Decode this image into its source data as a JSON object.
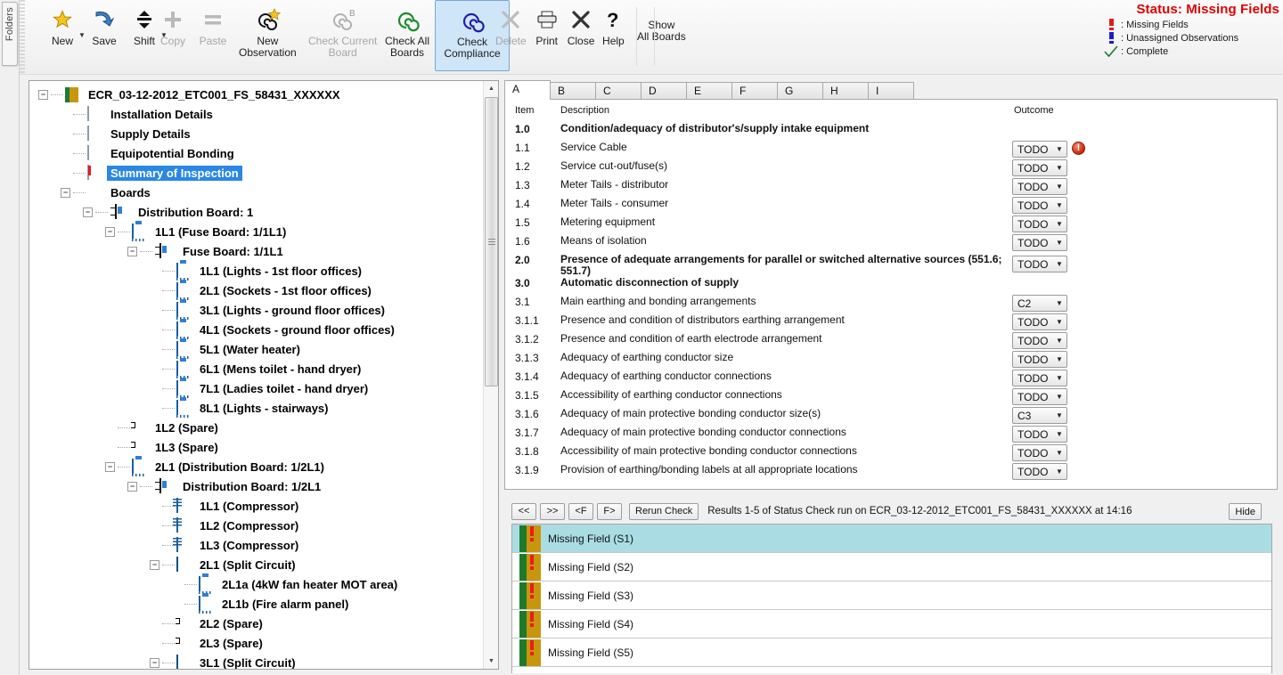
{
  "dock": {
    "folders_tab": "Folders"
  },
  "toolbar": {
    "buttons": [
      {
        "label": "New",
        "icon": "star-icon",
        "disabled": false,
        "dropdown": true
      },
      {
        "label": "Save",
        "icon": "save-icon",
        "disabled": false,
        "dropdown": false
      },
      {
        "label": "Shift",
        "icon": "shift-arrows-icon",
        "disabled": false,
        "dropdown": true
      },
      {
        "label": "Copy",
        "icon": "plus-icon",
        "disabled": true,
        "dropdown": false
      },
      {
        "label": "Paste",
        "icon": "equals-icon",
        "disabled": true,
        "dropdown": false
      },
      {
        "label": "New\nObservation",
        "icon": "spiral-star-icon",
        "disabled": false,
        "dropdown": false
      },
      {
        "label": "Check Current\nBoard",
        "icon": "spiral-b-icon",
        "disabled": true,
        "dropdown": false
      },
      {
        "label": "Check All\nBoards",
        "icon": "spiral-green-icon",
        "disabled": false,
        "dropdown": false
      },
      {
        "label": "Check\nCompliance",
        "icon": "spiral-blue-icon",
        "disabled": false,
        "dropdown": false,
        "active": true
      },
      {
        "label": "Delete",
        "icon": "x-delete-icon",
        "disabled": true,
        "dropdown": false
      },
      {
        "label": "Print",
        "icon": "printer-icon",
        "disabled": false,
        "dropdown": false
      },
      {
        "label": "Close",
        "icon": "x-close-icon",
        "disabled": false,
        "dropdown": false
      },
      {
        "label": "Help",
        "icon": "question-mark-icon",
        "disabled": false,
        "dropdown": false
      },
      {
        "label": "Show\nAll Boards",
        "icon": "none",
        "disabled": false,
        "dropdown": false
      }
    ]
  },
  "status": {
    "title": "Status: Missing Fields",
    "legend": [
      {
        "icon": "red-exclamation-icon",
        "color": "#e01b1b",
        "label": ": Missing Fields"
      },
      {
        "icon": "blue-exclamation-icon",
        "color": "#1b1bd0",
        "label": ": Unassigned Observations"
      },
      {
        "icon": "green-check-icon",
        "color": "#1d7a2b",
        "label": ": Complete"
      }
    ]
  },
  "tree": {
    "root": "ECR_03-12-2012_ETC001_FS_58431_XXXXXX",
    "items": [
      {
        "label": "ECR_03-12-2012_ETC001_FS_58431_XXXXXX",
        "indent": 0,
        "icon": "project-icon",
        "expander": "minus",
        "selected": false
      },
      {
        "label": "Installation Details",
        "indent": 1,
        "icon": "document-icon",
        "expander": "none",
        "selected": false
      },
      {
        "label": "Supply Details",
        "indent": 1,
        "icon": "document-icon",
        "expander": "none",
        "selected": false
      },
      {
        "label": "Equipotential Bonding",
        "indent": 1,
        "icon": "document-icon",
        "expander": "none",
        "selected": false
      },
      {
        "label": "Summary of Inspection",
        "indent": 1,
        "icon": "document-warning-icon",
        "expander": "none",
        "selected": true
      },
      {
        "label": "Boards",
        "indent": 1,
        "icon": "none",
        "expander": "minus",
        "selected": false
      },
      {
        "label": "Distribution Board: 1",
        "indent": 2,
        "icon": "board-icon",
        "expander": "minus",
        "selected": false
      },
      {
        "label": "1L1 (Fuse Board: 1/1L1)",
        "indent": 3,
        "icon": "way-icon",
        "expander": "minus",
        "selected": false
      },
      {
        "label": "Fuse Board: 1/1L1",
        "indent": 4,
        "icon": "board-icon",
        "expander": "minus",
        "selected": false
      },
      {
        "label": "1L1 (Lights - 1st floor offices)",
        "indent": 5,
        "icon": "way-icon",
        "expander": "none",
        "selected": false
      },
      {
        "label": "2L1 (Sockets - 1st floor offices)",
        "indent": 5,
        "icon": "way-icon",
        "expander": "none",
        "selected": false
      },
      {
        "label": "3L1 (Lights - ground floor offices)",
        "indent": 5,
        "icon": "way-icon",
        "expander": "none",
        "selected": false
      },
      {
        "label": "4L1 (Sockets - ground floor offices)",
        "indent": 5,
        "icon": "way-icon",
        "expander": "none",
        "selected": false
      },
      {
        "label": "5L1 (Water heater)",
        "indent": 5,
        "icon": "way-icon",
        "expander": "none",
        "selected": false
      },
      {
        "label": "6L1 (Mens toilet - hand dryer)",
        "indent": 5,
        "icon": "way-icon",
        "expander": "none",
        "selected": false
      },
      {
        "label": "7L1 (Ladies toilet - hand dryer)",
        "indent": 5,
        "icon": "way-icon",
        "expander": "none",
        "selected": false
      },
      {
        "label": "8L1 (Lights - stairways)",
        "indent": 5,
        "icon": "way-icon",
        "expander": "none",
        "selected": false
      },
      {
        "label": "1L2 (Spare)",
        "indent": 3,
        "icon": "spare-icon",
        "expander": "none",
        "selected": false
      },
      {
        "label": "1L3 (Spare)",
        "indent": 3,
        "icon": "spare-icon",
        "expander": "none",
        "selected": false
      },
      {
        "label": "2L1 (Distribution Board: 1/2L1)",
        "indent": 3,
        "icon": "way-icon",
        "expander": "minus",
        "selected": false
      },
      {
        "label": "Distribution Board: 1/2L1",
        "indent": 4,
        "icon": "board-icon",
        "expander": "minus",
        "selected": false
      },
      {
        "label": "1L1 (Compressor)",
        "indent": 5,
        "icon": "circuit-icon",
        "expander": "none",
        "selected": false
      },
      {
        "label": "1L2 (Compressor)",
        "indent": 5,
        "icon": "circuit-icon",
        "expander": "none",
        "selected": false
      },
      {
        "label": "1L3 (Compressor)",
        "indent": 5,
        "icon": "circuit-icon",
        "expander": "none",
        "selected": false
      },
      {
        "label": "2L1 (Split Circuit)",
        "indent": 5,
        "icon": "split-circuit-icon",
        "expander": "minus",
        "selected": false
      },
      {
        "label": "2L1a (4kW fan heater MOT area)",
        "indent": 6,
        "icon": "way-icon",
        "expander": "none",
        "selected": false
      },
      {
        "label": "2L1b (Fire alarm panel)",
        "indent": 6,
        "icon": "way-icon",
        "expander": "none",
        "selected": false
      },
      {
        "label": "2L2 (Spare)",
        "indent": 5,
        "icon": "spare-icon",
        "expander": "none",
        "selected": false
      },
      {
        "label": "2L3 (Spare)",
        "indent": 5,
        "icon": "spare-icon",
        "expander": "none",
        "selected": false
      },
      {
        "label": "3L1 (Split Circuit)",
        "indent": 5,
        "icon": "split-circuit-icon",
        "expander": "minus",
        "selected": false
      }
    ]
  },
  "content": {
    "tabs": [
      {
        "label": "A",
        "active": true
      },
      {
        "label": "B",
        "active": false
      },
      {
        "label": "C",
        "active": false
      },
      {
        "label": "D",
        "active": false
      },
      {
        "label": "E",
        "active": false
      },
      {
        "label": "F",
        "active": false
      },
      {
        "label": "G",
        "active": false
      },
      {
        "label": "H",
        "active": false
      },
      {
        "label": "I",
        "active": false
      }
    ],
    "columns": {
      "item": "Item",
      "description": "Description",
      "outcome": "Outcome"
    },
    "rows": [
      {
        "item": "1.0",
        "description": "Condition/adequacy of distributor's/supply intake equipment",
        "outcome": null,
        "section": true,
        "badge": null
      },
      {
        "item": "1.1",
        "description": "Service Cable",
        "outcome": "TODO",
        "section": false,
        "badge": "!"
      },
      {
        "item": "1.2",
        "description": "Service cut-out/fuse(s)",
        "outcome": "TODO",
        "section": false,
        "badge": null
      },
      {
        "item": "1.3",
        "description": "Meter Tails - distributor",
        "outcome": "TODO",
        "section": false,
        "badge": null
      },
      {
        "item": "1.4",
        "description": "Meter Tails - consumer",
        "outcome": "TODO",
        "section": false,
        "badge": null
      },
      {
        "item": "1.5",
        "description": "Metering equipment",
        "outcome": "TODO",
        "section": false,
        "badge": null
      },
      {
        "item": "1.6",
        "description": "Means of isolation",
        "outcome": "TODO",
        "section": false,
        "badge": null
      },
      {
        "item": "2.0",
        "description": "Presence of adequate arrangements for parallel or switched alternative sources (551.6; 551.7)",
        "outcome": "TODO",
        "section": true,
        "badge": null
      },
      {
        "item": "3.0",
        "description": "Automatic disconnection of supply",
        "outcome": null,
        "section": true,
        "badge": null
      },
      {
        "item": "3.1",
        "description": "Main earthing and bonding arrangements",
        "outcome": "C2",
        "section": false,
        "badge": null
      },
      {
        "item": "3.1.1",
        "description": "Presence and condition of distributors earthing arrangement",
        "outcome": "TODO",
        "section": false,
        "badge": null
      },
      {
        "item": "3.1.2",
        "description": "Presence and condition of earth electrode arrangement",
        "outcome": "TODO",
        "section": false,
        "badge": null
      },
      {
        "item": "3.1.3",
        "description": "Adequacy of earthing conductor size",
        "outcome": "TODO",
        "section": false,
        "badge": null
      },
      {
        "item": "3.1.4",
        "description": "Adequacy of earthing conductor connections",
        "outcome": "TODO",
        "section": false,
        "badge": null
      },
      {
        "item": "3.1.5",
        "description": "Accessibility of earthing conductor connections",
        "outcome": "TODO",
        "section": false,
        "badge": null
      },
      {
        "item": "3.1.6",
        "description": "Adequacy of main protective bonding conductor size(s)",
        "outcome": "C3",
        "section": false,
        "badge": null
      },
      {
        "item": "3.1.7",
        "description": "Adequacy of main protective bonding conductor connections",
        "outcome": "TODO",
        "section": false,
        "badge": null
      },
      {
        "item": "3.1.8",
        "description": "Accessibility of main protective bonding conductor connections",
        "outcome": "TODO",
        "section": false,
        "badge": null
      },
      {
        "item": "3.1.9",
        "description": "Provision of earthing/bonding labels at all appropriate locations",
        "outcome": "TODO",
        "section": false,
        "badge": null
      }
    ]
  },
  "results": {
    "nav": {
      "first": "<<",
      "last": ">>",
      "prev_field": "<F",
      "next_field": "F>"
    },
    "rerun_label": "Rerun Check",
    "summary": "Results 1-5 of Status Check run on ECR_03-12-2012_ETC001_FS_58431_XXXXXX at 14:16",
    "hide_label": "Hide",
    "rows": [
      {
        "label": "Missing Field (S1)",
        "selected": true
      },
      {
        "label": "Missing Field (S2)",
        "selected": false
      },
      {
        "label": "Missing Field (S3)",
        "selected": false
      },
      {
        "label": "Missing Field (S4)",
        "selected": false
      },
      {
        "label": "Missing Field (S5)",
        "selected": false
      }
    ]
  },
  "colors": {
    "status_red": "#e01b1b",
    "selection_blue": "#2a87e4",
    "result_select": "#aadde3",
    "active_tool": "#cfe5f8"
  }
}
